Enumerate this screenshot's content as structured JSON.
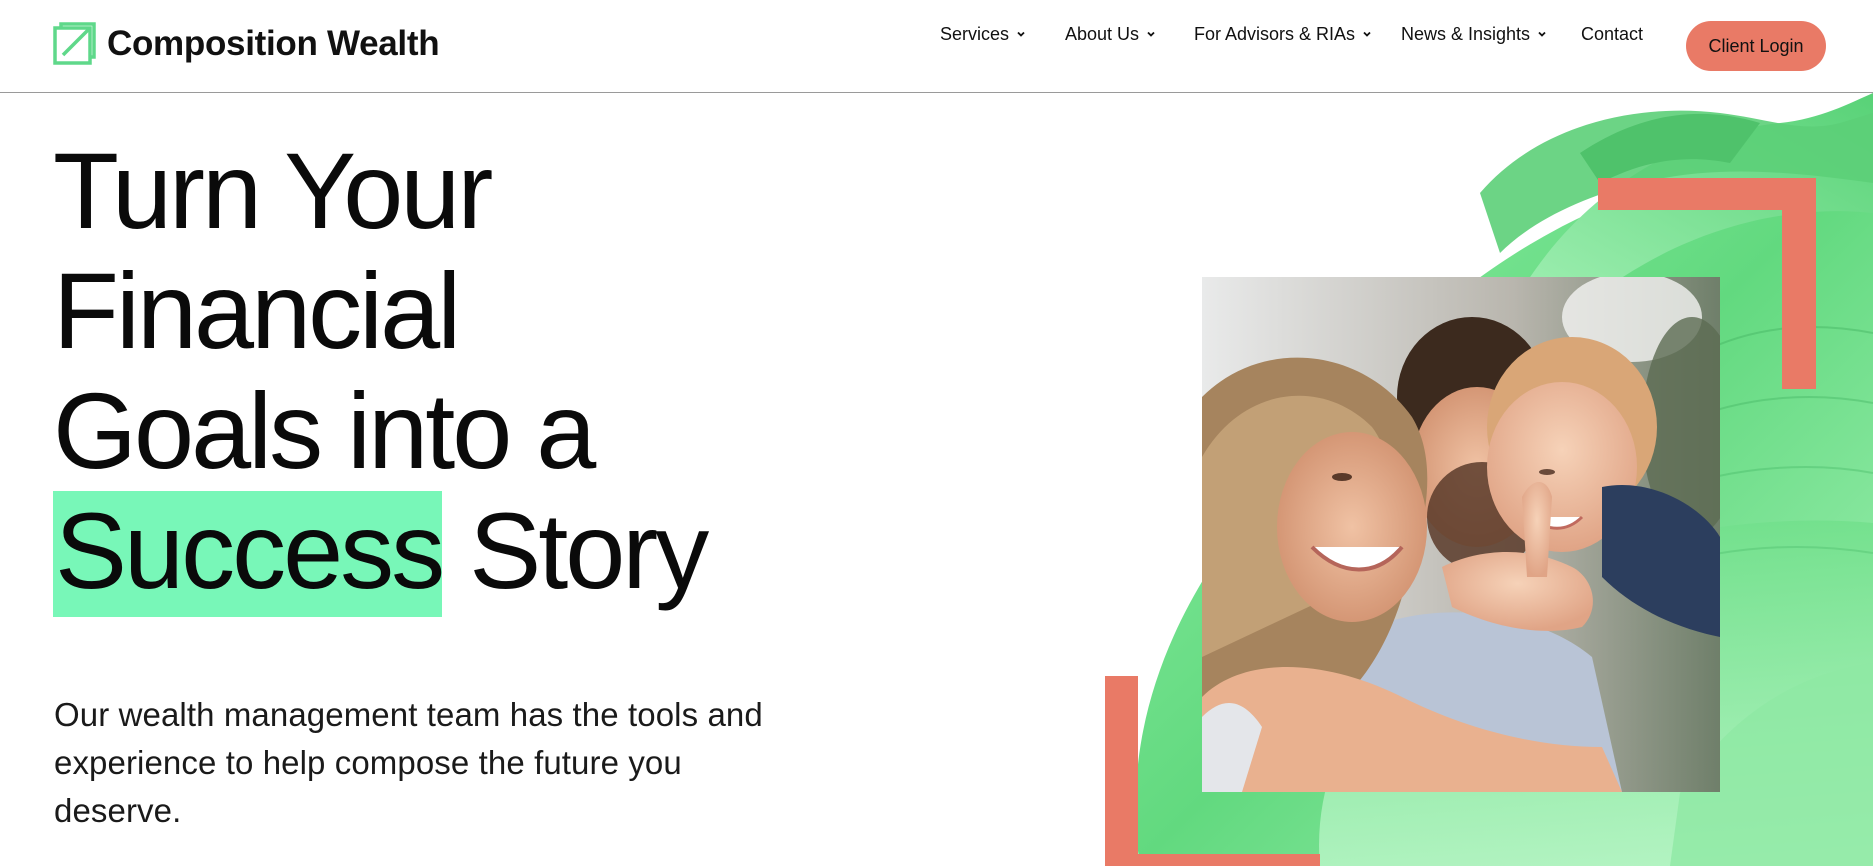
{
  "brand": {
    "name": "Composition Wealth",
    "logo_icon": "square-arrow-logo",
    "accent": "#e97a66",
    "highlight": "#78f7b8",
    "green": "#5fd88a"
  },
  "nav": {
    "items": [
      {
        "label": "Services",
        "has_dropdown": true
      },
      {
        "label": "About Us",
        "has_dropdown": true
      },
      {
        "label": "For Advisors & RIAs",
        "has_dropdown": true
      },
      {
        "label": "News & Insights",
        "has_dropdown": true
      },
      {
        "label": "Contact",
        "has_dropdown": false
      }
    ],
    "login_label": "Client Login"
  },
  "hero": {
    "title_line1": "Turn Your",
    "title_line2": "Financial",
    "title_line3": "Goals into a",
    "title_highlight": "Success",
    "title_rest": "Story",
    "subtitle": "Our wealth management team has the tools and experience to help compose the future you deserve.",
    "photo_alt": "family-photo"
  }
}
